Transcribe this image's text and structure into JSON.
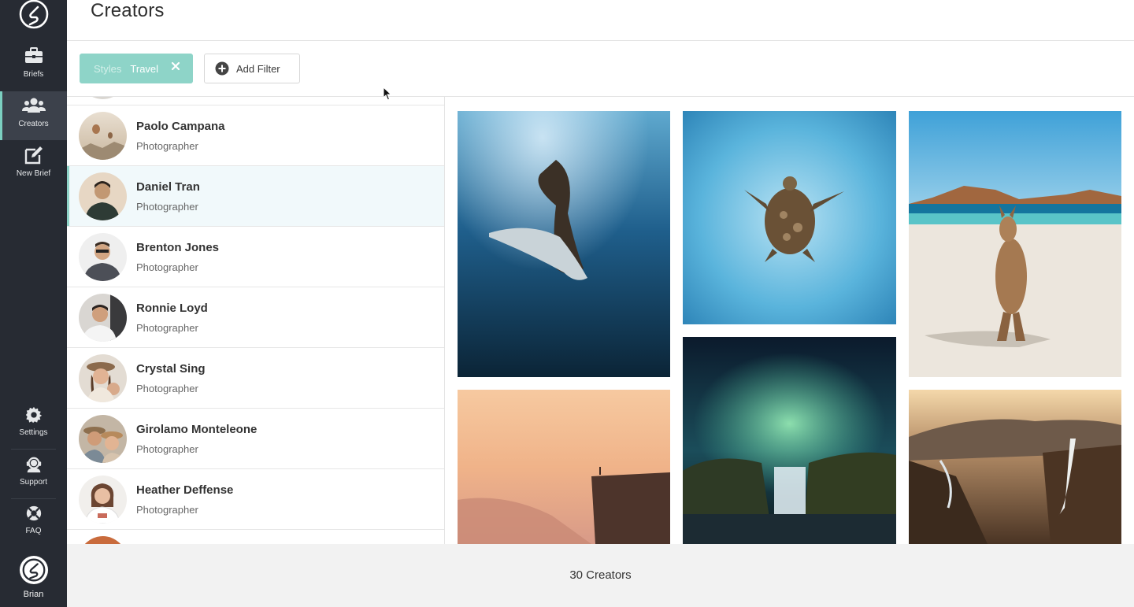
{
  "header": {
    "title": "Creators"
  },
  "sidebar": {
    "items": [
      {
        "label": "Briefs",
        "icon": "briefcase-icon"
      },
      {
        "label": "Creators",
        "icon": "users-icon"
      },
      {
        "label": "New Brief",
        "icon": "edit-icon"
      },
      {
        "label": "Settings",
        "icon": "gear-icon"
      },
      {
        "label": "Support",
        "icon": "headset-icon"
      },
      {
        "label": "FAQ",
        "icon": "lifebuoy-icon"
      }
    ],
    "user": {
      "label": "Brian"
    }
  },
  "filters": {
    "chip": {
      "key": "Styles",
      "value": "Travel"
    },
    "add_label": "Add Filter"
  },
  "creators": [
    {
      "name": "Paolo Campana",
      "role": "Photographer"
    },
    {
      "name": "Daniel Tran",
      "role": "Photographer"
    },
    {
      "name": "Brenton Jones",
      "role": "Photographer"
    },
    {
      "name": "Ronnie Loyd",
      "role": "Photographer"
    },
    {
      "name": "Crystal Sing",
      "role": "Photographer"
    },
    {
      "name": "Girolamo Monteleone",
      "role": "Photographer"
    },
    {
      "name": "Heather Deffense",
      "role": "Photographer"
    }
  ],
  "footer": {
    "count_label": "30 Creators"
  },
  "colors": {
    "sidebar": "#272b33",
    "accent": "#8ed4c8",
    "selected_row": "#f1f9fb"
  }
}
